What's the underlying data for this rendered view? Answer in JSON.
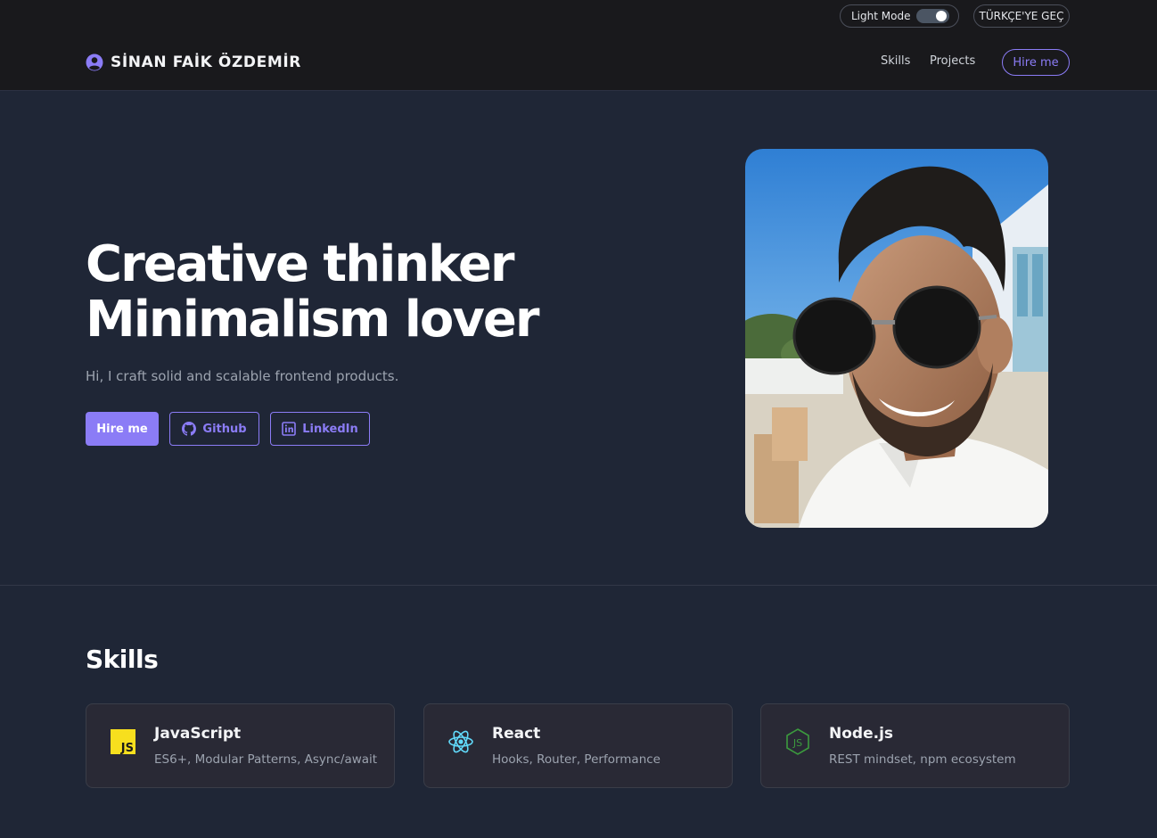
{
  "header": {
    "mode_toggle_label": "Light Mode",
    "language_switch_label": "TÜRKÇE'YE GEÇ",
    "brand_name": "SİNAN FAİK ÖZDEMİR",
    "nav": {
      "skills": "Skills",
      "projects": "Projects",
      "hire": "Hire me"
    }
  },
  "hero": {
    "title_line1": "Creative thinker",
    "title_line2": "Minimalism lover",
    "subtitle": "Hi, I craft solid and scalable frontend products.",
    "buttons": {
      "hire": "Hire me",
      "github": "Github",
      "linkedin": "LinkedIn"
    },
    "portrait_alt": "profile photo"
  },
  "skills": {
    "title": "Skills",
    "items": [
      {
        "name": "JavaScript",
        "desc": "ES6+, Modular Patterns, Async/await",
        "icon": "javascript-icon"
      },
      {
        "name": "React",
        "desc": "Hooks, Router, Performance",
        "icon": "react-icon"
      },
      {
        "name": "Node.js",
        "desc": "REST mindset, npm ecosystem",
        "icon": "nodejs-icon"
      }
    ]
  },
  "colors": {
    "accent": "#8b7cf6",
    "background": "#1f2636",
    "header_bg": "#19191c",
    "card_bg": "#292935"
  }
}
